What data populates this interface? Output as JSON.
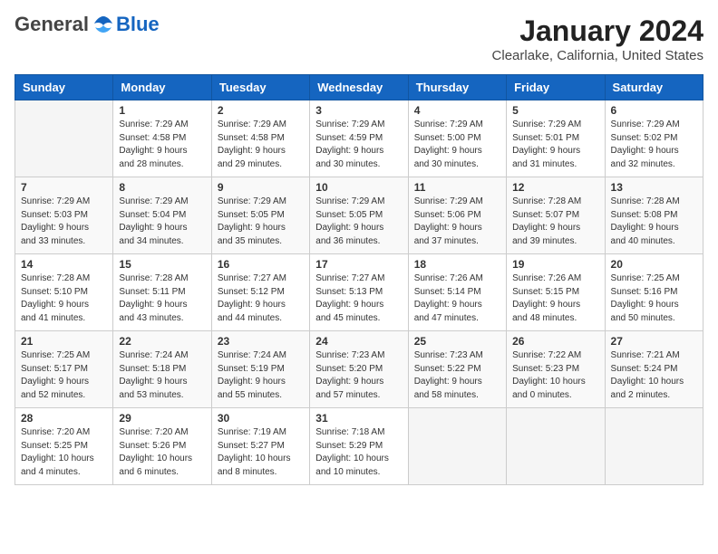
{
  "logo": {
    "general": "General",
    "blue": "Blue"
  },
  "title": "January 2024",
  "subtitle": "Clearlake, California, United States",
  "weekdays": [
    "Sunday",
    "Monday",
    "Tuesday",
    "Wednesday",
    "Thursday",
    "Friday",
    "Saturday"
  ],
  "weeks": [
    [
      {
        "day": "",
        "info": ""
      },
      {
        "day": "1",
        "info": "Sunrise: 7:29 AM\nSunset: 4:58 PM\nDaylight: 9 hours\nand 28 minutes."
      },
      {
        "day": "2",
        "info": "Sunrise: 7:29 AM\nSunset: 4:58 PM\nDaylight: 9 hours\nand 29 minutes."
      },
      {
        "day": "3",
        "info": "Sunrise: 7:29 AM\nSunset: 4:59 PM\nDaylight: 9 hours\nand 30 minutes."
      },
      {
        "day": "4",
        "info": "Sunrise: 7:29 AM\nSunset: 5:00 PM\nDaylight: 9 hours\nand 30 minutes."
      },
      {
        "day": "5",
        "info": "Sunrise: 7:29 AM\nSunset: 5:01 PM\nDaylight: 9 hours\nand 31 minutes."
      },
      {
        "day": "6",
        "info": "Sunrise: 7:29 AM\nSunset: 5:02 PM\nDaylight: 9 hours\nand 32 minutes."
      }
    ],
    [
      {
        "day": "7",
        "info": "Sunrise: 7:29 AM\nSunset: 5:03 PM\nDaylight: 9 hours\nand 33 minutes."
      },
      {
        "day": "8",
        "info": "Sunrise: 7:29 AM\nSunset: 5:04 PM\nDaylight: 9 hours\nand 34 minutes."
      },
      {
        "day": "9",
        "info": "Sunrise: 7:29 AM\nSunset: 5:05 PM\nDaylight: 9 hours\nand 35 minutes."
      },
      {
        "day": "10",
        "info": "Sunrise: 7:29 AM\nSunset: 5:05 PM\nDaylight: 9 hours\nand 36 minutes."
      },
      {
        "day": "11",
        "info": "Sunrise: 7:29 AM\nSunset: 5:06 PM\nDaylight: 9 hours\nand 37 minutes."
      },
      {
        "day": "12",
        "info": "Sunrise: 7:28 AM\nSunset: 5:07 PM\nDaylight: 9 hours\nand 39 minutes."
      },
      {
        "day": "13",
        "info": "Sunrise: 7:28 AM\nSunset: 5:08 PM\nDaylight: 9 hours\nand 40 minutes."
      }
    ],
    [
      {
        "day": "14",
        "info": "Sunrise: 7:28 AM\nSunset: 5:10 PM\nDaylight: 9 hours\nand 41 minutes."
      },
      {
        "day": "15",
        "info": "Sunrise: 7:28 AM\nSunset: 5:11 PM\nDaylight: 9 hours\nand 43 minutes."
      },
      {
        "day": "16",
        "info": "Sunrise: 7:27 AM\nSunset: 5:12 PM\nDaylight: 9 hours\nand 44 minutes."
      },
      {
        "day": "17",
        "info": "Sunrise: 7:27 AM\nSunset: 5:13 PM\nDaylight: 9 hours\nand 45 minutes."
      },
      {
        "day": "18",
        "info": "Sunrise: 7:26 AM\nSunset: 5:14 PM\nDaylight: 9 hours\nand 47 minutes."
      },
      {
        "day": "19",
        "info": "Sunrise: 7:26 AM\nSunset: 5:15 PM\nDaylight: 9 hours\nand 48 minutes."
      },
      {
        "day": "20",
        "info": "Sunrise: 7:25 AM\nSunset: 5:16 PM\nDaylight: 9 hours\nand 50 minutes."
      }
    ],
    [
      {
        "day": "21",
        "info": "Sunrise: 7:25 AM\nSunset: 5:17 PM\nDaylight: 9 hours\nand 52 minutes."
      },
      {
        "day": "22",
        "info": "Sunrise: 7:24 AM\nSunset: 5:18 PM\nDaylight: 9 hours\nand 53 minutes."
      },
      {
        "day": "23",
        "info": "Sunrise: 7:24 AM\nSunset: 5:19 PM\nDaylight: 9 hours\nand 55 minutes."
      },
      {
        "day": "24",
        "info": "Sunrise: 7:23 AM\nSunset: 5:20 PM\nDaylight: 9 hours\nand 57 minutes."
      },
      {
        "day": "25",
        "info": "Sunrise: 7:23 AM\nSunset: 5:22 PM\nDaylight: 9 hours\nand 58 minutes."
      },
      {
        "day": "26",
        "info": "Sunrise: 7:22 AM\nSunset: 5:23 PM\nDaylight: 10 hours\nand 0 minutes."
      },
      {
        "day": "27",
        "info": "Sunrise: 7:21 AM\nSunset: 5:24 PM\nDaylight: 10 hours\nand 2 minutes."
      }
    ],
    [
      {
        "day": "28",
        "info": "Sunrise: 7:20 AM\nSunset: 5:25 PM\nDaylight: 10 hours\nand 4 minutes."
      },
      {
        "day": "29",
        "info": "Sunrise: 7:20 AM\nSunset: 5:26 PM\nDaylight: 10 hours\nand 6 minutes."
      },
      {
        "day": "30",
        "info": "Sunrise: 7:19 AM\nSunset: 5:27 PM\nDaylight: 10 hours\nand 8 minutes."
      },
      {
        "day": "31",
        "info": "Sunrise: 7:18 AM\nSunset: 5:29 PM\nDaylight: 10 hours\nand 10 minutes."
      },
      {
        "day": "",
        "info": ""
      },
      {
        "day": "",
        "info": ""
      },
      {
        "day": "",
        "info": ""
      }
    ]
  ]
}
